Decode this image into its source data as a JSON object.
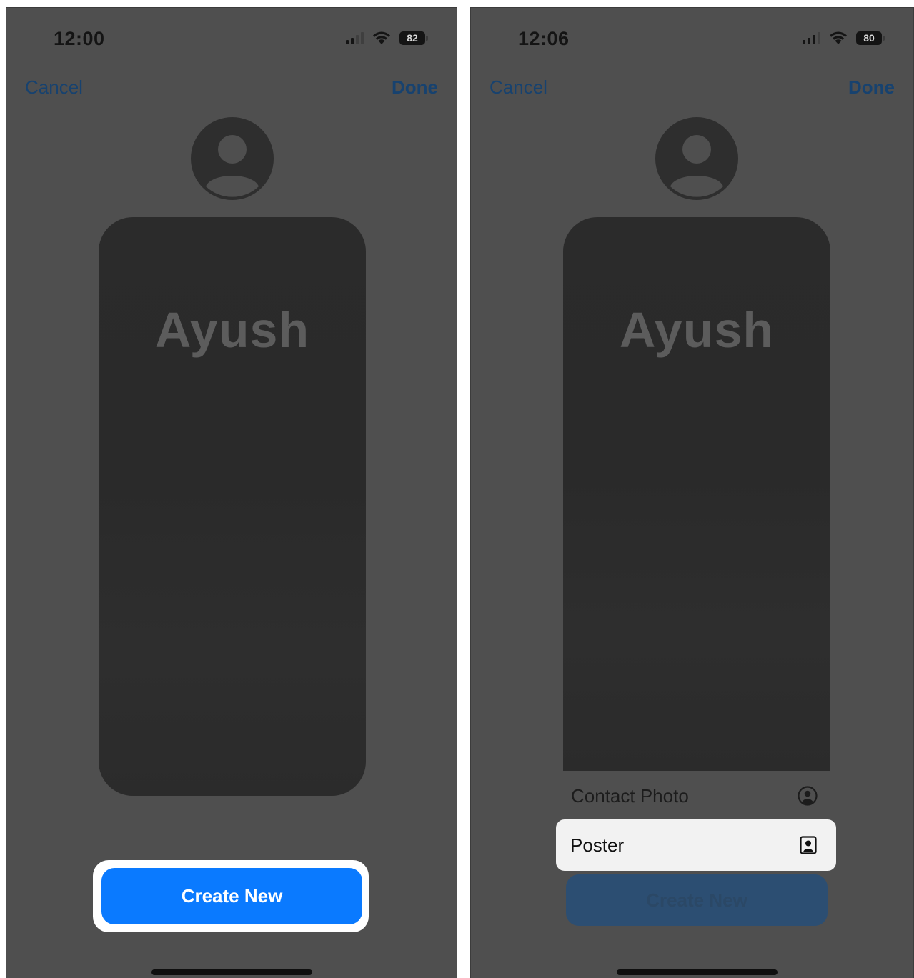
{
  "left_screen": {
    "status": {
      "time": "12:00",
      "battery": "82"
    },
    "nav": {
      "cancel": "Cancel",
      "done": "Done"
    },
    "poster_name": "Ayush",
    "create_button": "Create New"
  },
  "right_screen": {
    "status": {
      "time": "12:06",
      "battery": "80"
    },
    "nav": {
      "cancel": "Cancel",
      "done": "Done"
    },
    "poster_name": "Ayush",
    "menu": [
      {
        "label": "Contact Photo",
        "icon": "person-circle-icon"
      },
      {
        "label": "Poster",
        "icon": "person-square-icon"
      }
    ],
    "create_button": "Create New"
  }
}
